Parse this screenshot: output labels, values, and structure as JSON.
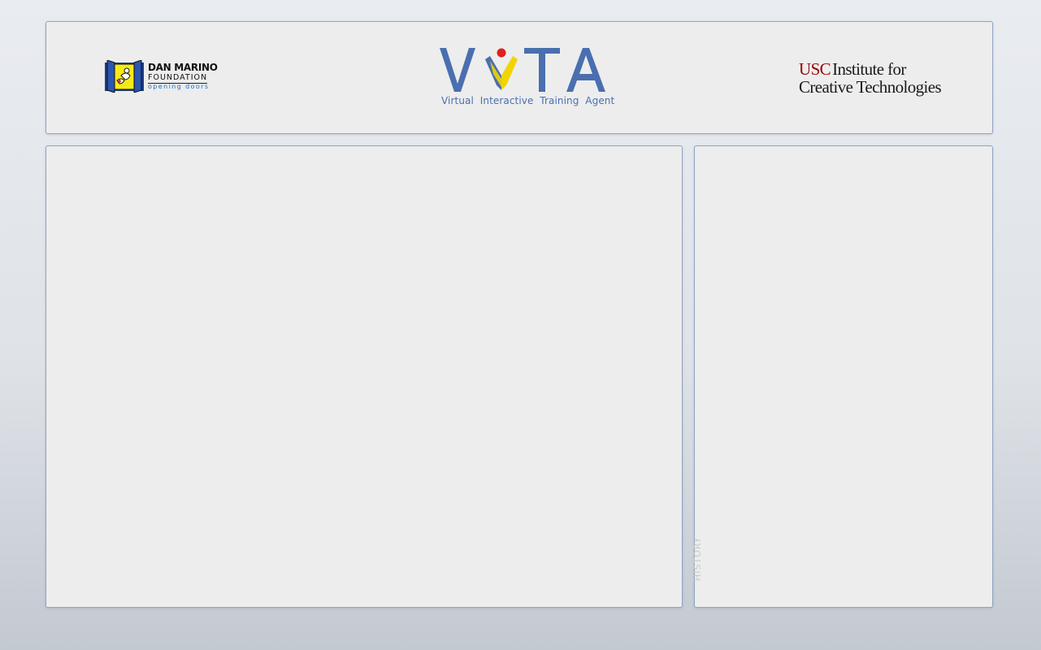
{
  "header": {
    "sponsor_logo": {
      "line1": "DAN MARINO",
      "line2": "FOUNDATION",
      "line3": "opening doors"
    },
    "app_logo": {
      "title": "VITA",
      "subtitle": "Virtual  Interactive  Training  Agent",
      "colors": {
        "primary": "#4a6faf",
        "accent_red": "#e02020",
        "accent_yellow": "#f2d400"
      }
    },
    "partner_logo": {
      "brand": "USC",
      "line1_rest": "Institute for",
      "line2": "Creative Technologies",
      "brand_color": "#990000"
    }
  },
  "main": {
    "content": ""
  },
  "sidebar": {
    "label": "HISTORY"
  }
}
